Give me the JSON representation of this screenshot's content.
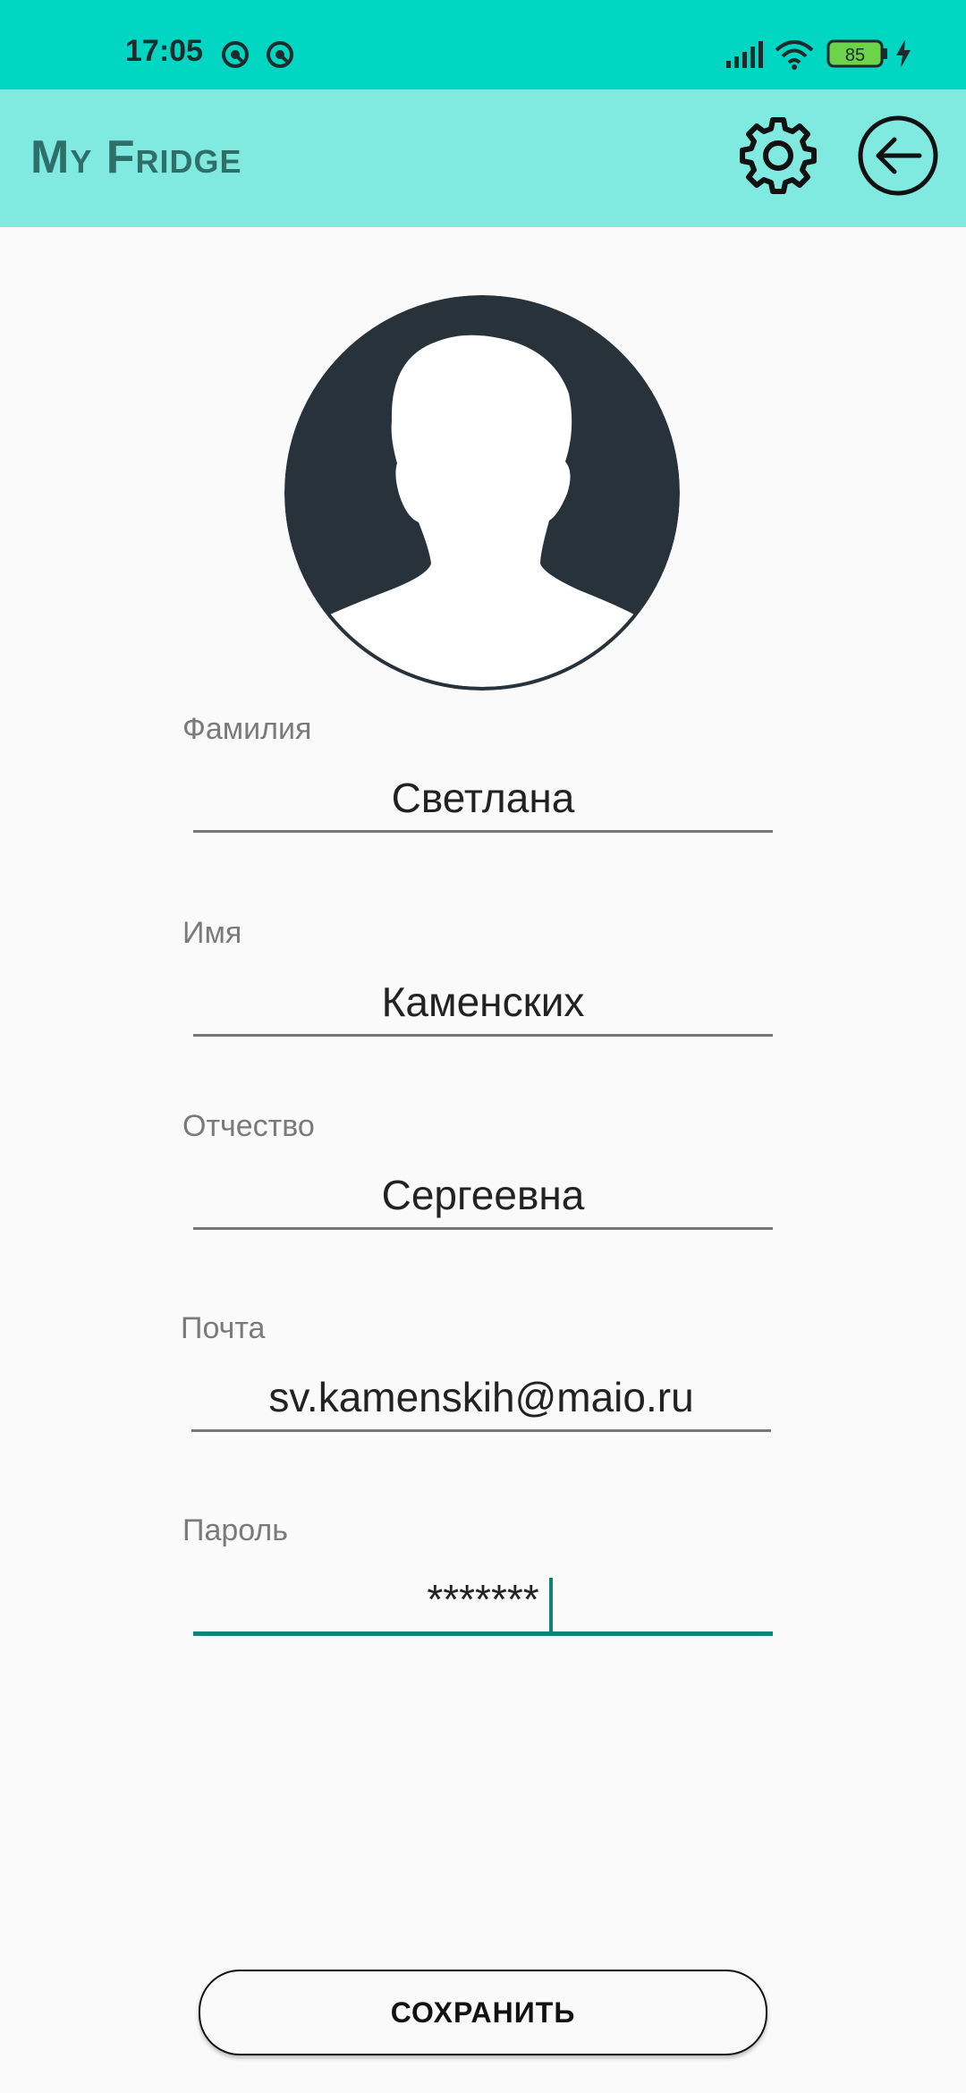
{
  "status": {
    "time": "17:05",
    "battery": "85",
    "icons": [
      "sync-icon",
      "sync-icon",
      "signal-icon",
      "wifi-icon",
      "battery-icon",
      "charging-icon"
    ]
  },
  "appbar": {
    "title": "My Fridge",
    "settings_icon": "gear-icon",
    "back_icon": "back-arrow-icon",
    "color_bg": "#80eae0",
    "color_status": "#00d6c2"
  },
  "profile": {
    "avatar_icon": "person-avatar-icon",
    "fields": [
      {
        "label": "Фамилия",
        "value": "Светлана"
      },
      {
        "label": "Имя",
        "value": "Каменских"
      },
      {
        "label": "Отчество",
        "value": "Сергеевна"
      },
      {
        "label": "Почта",
        "value": "sv.kamenskih@maio.ru"
      },
      {
        "label": "Пароль",
        "value": "*******"
      }
    ]
  },
  "actions": {
    "save_label": "СОХРАНИТЬ"
  },
  "colors": {
    "accent": "#0f8377",
    "title": "#2e6f6a"
  }
}
